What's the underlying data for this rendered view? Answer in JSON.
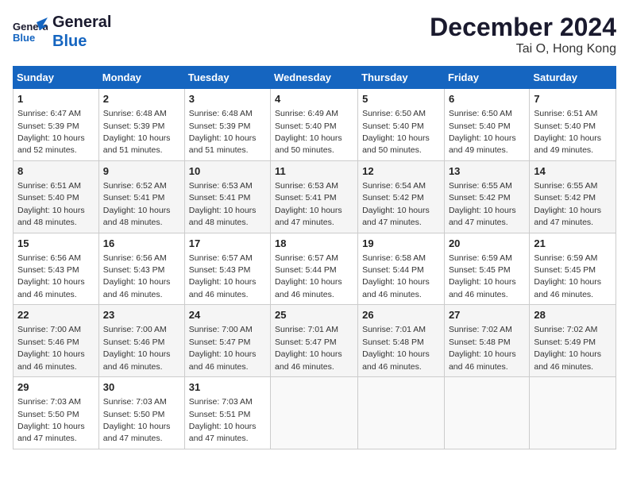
{
  "header": {
    "logo_line1": "General",
    "logo_line2": "Blue",
    "month_year": "December 2024",
    "location": "Tai O, Hong Kong"
  },
  "weekdays": [
    "Sunday",
    "Monday",
    "Tuesday",
    "Wednesday",
    "Thursday",
    "Friday",
    "Saturday"
  ],
  "weeks": [
    [
      {
        "day": "1",
        "sunrise": "Sunrise: 6:47 AM",
        "sunset": "Sunset: 5:39 PM",
        "daylight": "Daylight: 10 hours and 52 minutes."
      },
      {
        "day": "2",
        "sunrise": "Sunrise: 6:48 AM",
        "sunset": "Sunset: 5:39 PM",
        "daylight": "Daylight: 10 hours and 51 minutes."
      },
      {
        "day": "3",
        "sunrise": "Sunrise: 6:48 AM",
        "sunset": "Sunset: 5:39 PM",
        "daylight": "Daylight: 10 hours and 51 minutes."
      },
      {
        "day": "4",
        "sunrise": "Sunrise: 6:49 AM",
        "sunset": "Sunset: 5:40 PM",
        "daylight": "Daylight: 10 hours and 50 minutes."
      },
      {
        "day": "5",
        "sunrise": "Sunrise: 6:50 AM",
        "sunset": "Sunset: 5:40 PM",
        "daylight": "Daylight: 10 hours and 50 minutes."
      },
      {
        "day": "6",
        "sunrise": "Sunrise: 6:50 AM",
        "sunset": "Sunset: 5:40 PM",
        "daylight": "Daylight: 10 hours and 49 minutes."
      },
      {
        "day": "7",
        "sunrise": "Sunrise: 6:51 AM",
        "sunset": "Sunset: 5:40 PM",
        "daylight": "Daylight: 10 hours and 49 minutes."
      }
    ],
    [
      {
        "day": "8",
        "sunrise": "Sunrise: 6:51 AM",
        "sunset": "Sunset: 5:40 PM",
        "daylight": "Daylight: 10 hours and 48 minutes."
      },
      {
        "day": "9",
        "sunrise": "Sunrise: 6:52 AM",
        "sunset": "Sunset: 5:41 PM",
        "daylight": "Daylight: 10 hours and 48 minutes."
      },
      {
        "day": "10",
        "sunrise": "Sunrise: 6:53 AM",
        "sunset": "Sunset: 5:41 PM",
        "daylight": "Daylight: 10 hours and 48 minutes."
      },
      {
        "day": "11",
        "sunrise": "Sunrise: 6:53 AM",
        "sunset": "Sunset: 5:41 PM",
        "daylight": "Daylight: 10 hours and 47 minutes."
      },
      {
        "day": "12",
        "sunrise": "Sunrise: 6:54 AM",
        "sunset": "Sunset: 5:42 PM",
        "daylight": "Daylight: 10 hours and 47 minutes."
      },
      {
        "day": "13",
        "sunrise": "Sunrise: 6:55 AM",
        "sunset": "Sunset: 5:42 PM",
        "daylight": "Daylight: 10 hours and 47 minutes."
      },
      {
        "day": "14",
        "sunrise": "Sunrise: 6:55 AM",
        "sunset": "Sunset: 5:42 PM",
        "daylight": "Daylight: 10 hours and 47 minutes."
      }
    ],
    [
      {
        "day": "15",
        "sunrise": "Sunrise: 6:56 AM",
        "sunset": "Sunset: 5:43 PM",
        "daylight": "Daylight: 10 hours and 46 minutes."
      },
      {
        "day": "16",
        "sunrise": "Sunrise: 6:56 AM",
        "sunset": "Sunset: 5:43 PM",
        "daylight": "Daylight: 10 hours and 46 minutes."
      },
      {
        "day": "17",
        "sunrise": "Sunrise: 6:57 AM",
        "sunset": "Sunset: 5:43 PM",
        "daylight": "Daylight: 10 hours and 46 minutes."
      },
      {
        "day": "18",
        "sunrise": "Sunrise: 6:57 AM",
        "sunset": "Sunset: 5:44 PM",
        "daylight": "Daylight: 10 hours and 46 minutes."
      },
      {
        "day": "19",
        "sunrise": "Sunrise: 6:58 AM",
        "sunset": "Sunset: 5:44 PM",
        "daylight": "Daylight: 10 hours and 46 minutes."
      },
      {
        "day": "20",
        "sunrise": "Sunrise: 6:59 AM",
        "sunset": "Sunset: 5:45 PM",
        "daylight": "Daylight: 10 hours and 46 minutes."
      },
      {
        "day": "21",
        "sunrise": "Sunrise: 6:59 AM",
        "sunset": "Sunset: 5:45 PM",
        "daylight": "Daylight: 10 hours and 46 minutes."
      }
    ],
    [
      {
        "day": "22",
        "sunrise": "Sunrise: 7:00 AM",
        "sunset": "Sunset: 5:46 PM",
        "daylight": "Daylight: 10 hours and 46 minutes."
      },
      {
        "day": "23",
        "sunrise": "Sunrise: 7:00 AM",
        "sunset": "Sunset: 5:46 PM",
        "daylight": "Daylight: 10 hours and 46 minutes."
      },
      {
        "day": "24",
        "sunrise": "Sunrise: 7:00 AM",
        "sunset": "Sunset: 5:47 PM",
        "daylight": "Daylight: 10 hours and 46 minutes."
      },
      {
        "day": "25",
        "sunrise": "Sunrise: 7:01 AM",
        "sunset": "Sunset: 5:47 PM",
        "daylight": "Daylight: 10 hours and 46 minutes."
      },
      {
        "day": "26",
        "sunrise": "Sunrise: 7:01 AM",
        "sunset": "Sunset: 5:48 PM",
        "daylight": "Daylight: 10 hours and 46 minutes."
      },
      {
        "day": "27",
        "sunrise": "Sunrise: 7:02 AM",
        "sunset": "Sunset: 5:48 PM",
        "daylight": "Daylight: 10 hours and 46 minutes."
      },
      {
        "day": "28",
        "sunrise": "Sunrise: 7:02 AM",
        "sunset": "Sunset: 5:49 PM",
        "daylight": "Daylight: 10 hours and 46 minutes."
      }
    ],
    [
      {
        "day": "29",
        "sunrise": "Sunrise: 7:03 AM",
        "sunset": "Sunset: 5:50 PM",
        "daylight": "Daylight: 10 hours and 47 minutes."
      },
      {
        "day": "30",
        "sunrise": "Sunrise: 7:03 AM",
        "sunset": "Sunset: 5:50 PM",
        "daylight": "Daylight: 10 hours and 47 minutes."
      },
      {
        "day": "31",
        "sunrise": "Sunrise: 7:03 AM",
        "sunset": "Sunset: 5:51 PM",
        "daylight": "Daylight: 10 hours and 47 minutes."
      },
      null,
      null,
      null,
      null
    ]
  ]
}
